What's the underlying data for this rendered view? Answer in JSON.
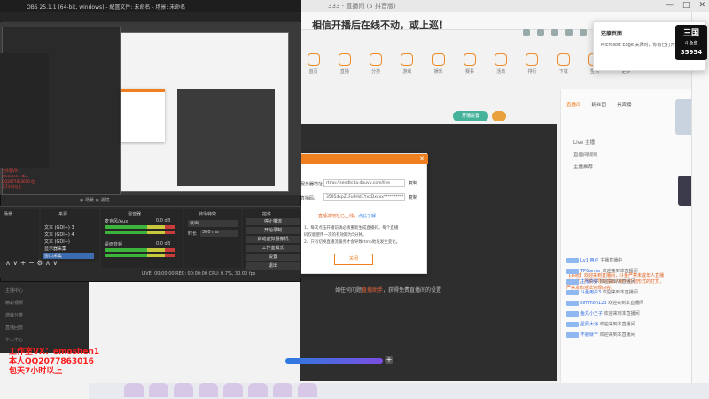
{
  "browser": {
    "tab_title": "333 - 直播间 (5 抖音版)",
    "heading": "相信开播后在线不动，或上巡！",
    "controls": [
      "—",
      "□",
      "✕"
    ]
  },
  "site_nav": [
    "首页",
    "直播",
    "分类",
    "游戏",
    "娱乐",
    "赛事",
    "活动",
    "排行",
    "下载",
    "签到",
    "更多"
  ],
  "video": {
    "tab_label": "开播设置",
    "hint_prefix": "如任何问题",
    "hint_link": "直播助手",
    "hint_suffix": "，获得免费直播间的设置",
    "plus": "+"
  },
  "modal": {
    "server_label": "服务器地址:",
    "server_value": "rtmp://sendtc3a.douyu.com/live",
    "key_label": "直播码:",
    "key_value": "3595dkpZLFu9HdCYxxDxxxx**********",
    "copy": "复制",
    "warn": "直播流地址已上线，",
    "warn_link": "点此了解",
    "notes": [
      "1、每次点击开播前请必须重新生成直播码，每个直播",
      "码仅能使用一次的有效期为5分钟。",
      "2、只有切换直播流服务才会导致rtmp地址发生变化。"
    ],
    "button": "关闭"
  },
  "chat": {
    "tabs": [
      "直播间",
      "粉丝团",
      "贵宾榜"
    ],
    "menu": [
      "Live 主播",
      "直播间规则",
      "主播推荐"
    ],
    "promo": "【系统】欢迎来到直播间，斗鱼严禁未成年人直播或打赏，严禁引导未成年人参与任何形式的打赏，严禁发布违法违规内容。",
    "lines": [
      {
        "name": "Lv1 用户",
        "text": "主播直播中"
      },
      {
        "name": "TPGamer",
        "text": "欢迎来到本直播间"
      },
      {
        "name": "主播你好",
        "text": "欢迎来到本直播间"
      },
      {
        "name": "斗鱼用户3",
        "text": "欢迎来到本直播间"
      },
      {
        "name": "simmon123",
        "text": "欢迎来到本直播间"
      },
      {
        "name": "鱼丸小王子",
        "text": "欢迎来到本直播间"
      },
      {
        "name": "星辰大海",
        "text": "欢迎来到本直播间"
      },
      {
        "name": "不服就干",
        "text": "欢迎来到本直播间"
      }
    ]
  },
  "notification": {
    "title": "还原页面",
    "body": "Microsoft Edge 关闭时，你有已打开的..."
  },
  "badge": {
    "logo": "三国",
    "name": "斗鱼鱼",
    "number": "35954"
  },
  "obs": {
    "title": "OBS 25.1.1 (64-bit, windows) - 配置文件: 未命名 - 场景: 未命名",
    "scene_icons": "◉ 场景  ◉ 滤镜",
    "dock_titles": [
      "场景",
      "来源",
      "混音器",
      "转场特效",
      "控件"
    ],
    "sources": [
      "文本 (GDI+) 3",
      "文本 (GDI+) 4",
      "文本 (GDI+)",
      "显示器采集",
      "窗口采集"
    ],
    "mixer": [
      {
        "name": "麦克风/Aux",
        "db": "0.0 dB"
      },
      {
        "name": "桌面音频",
        "db": "0.0 dB"
      }
    ],
    "transition": {
      "label": "淡出",
      "duration_label": "时长",
      "duration": "300 ms"
    },
    "controls": [
      "停止推流",
      "开始录制",
      "启动虚拟摄像机",
      "工作室模式",
      "设置",
      "退出"
    ],
    "status": "LIVE: 00:00:00   REC: 00:00:00   CPU: 0.7%, 30.00 fps",
    "arrows": "∧ ∨  + − ⚙ ∧ ∨",
    "left_red": "工作室VX: emoshen1 本人QQ2077863016 包天7小时以上"
  },
  "left_lower": [
    "主播中心",
    "精彩视频",
    "游戏分类",
    "直播回放",
    "个人中心"
  ],
  "ad": [
    "工作室VX：emoshen1",
    "本人QQ2077863016",
    "包天7小时以上"
  ]
}
